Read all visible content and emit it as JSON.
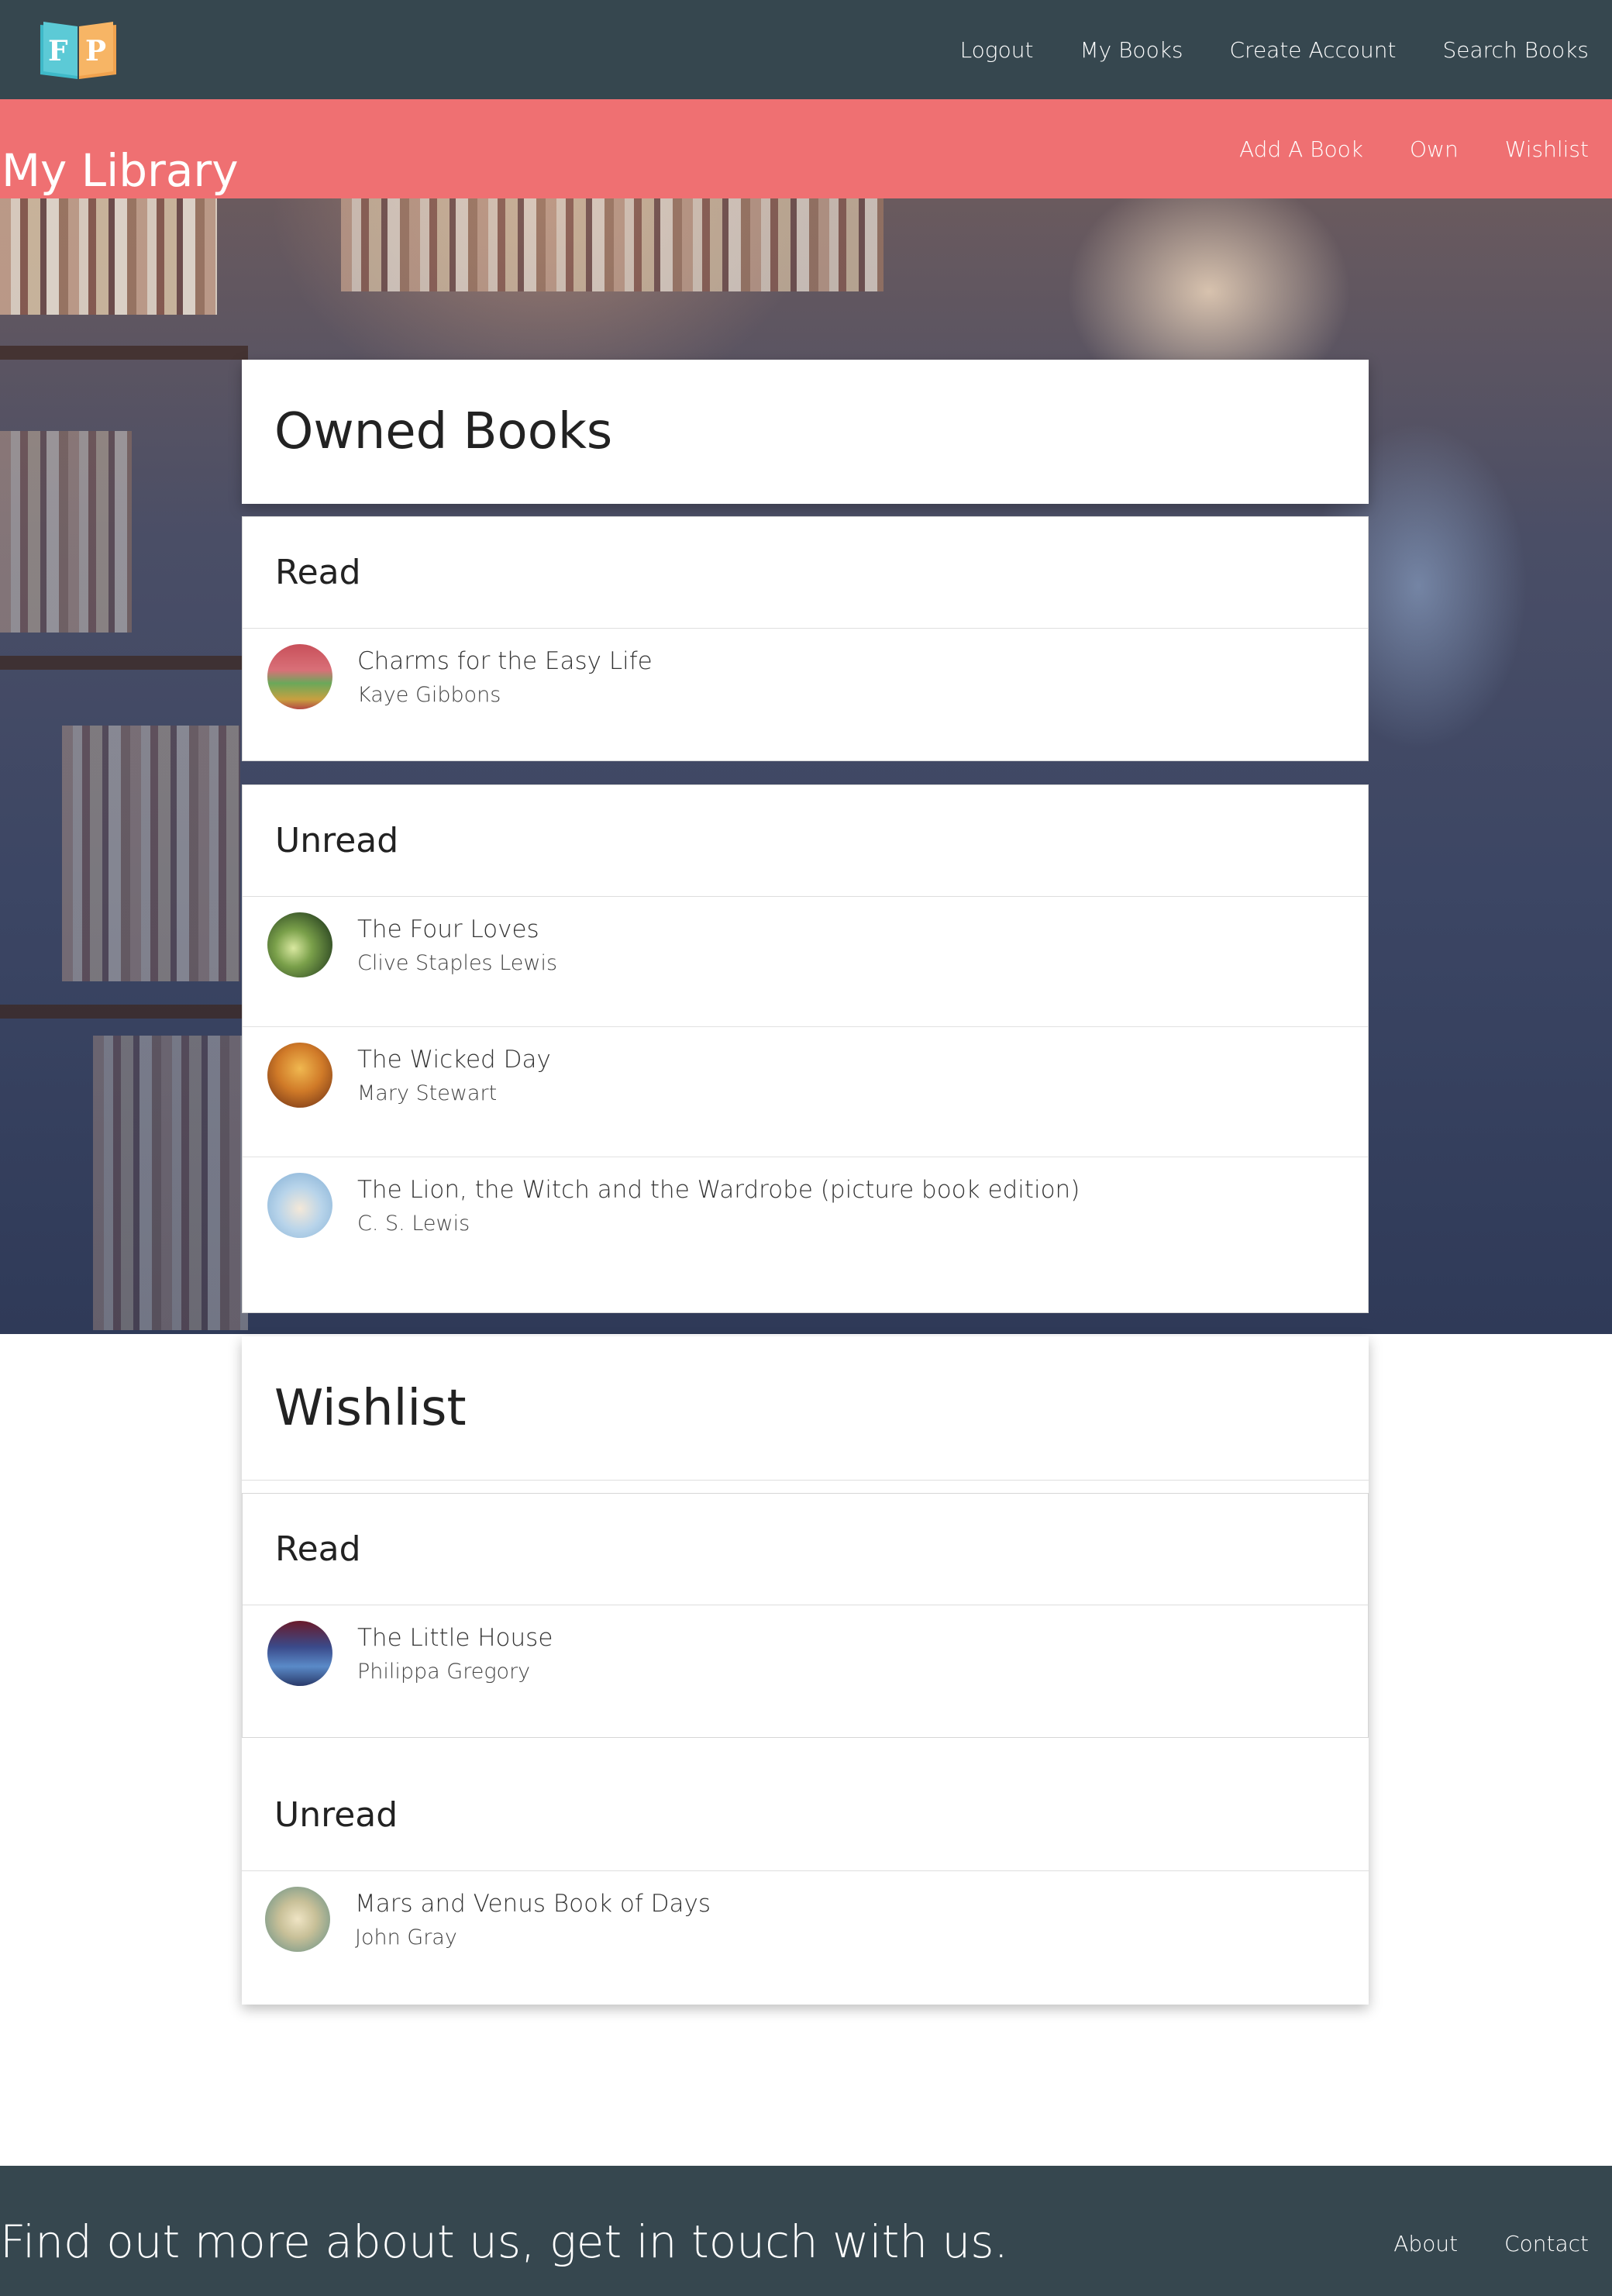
{
  "topnav": {
    "logo_letters": "F P",
    "links": [
      "Logout",
      "My Books",
      "Create Account",
      "Search Books"
    ]
  },
  "subnav": {
    "title": "My Library",
    "links": [
      "Add A Book",
      "Own",
      "Wishlist"
    ]
  },
  "owned": {
    "title": "Owned Books",
    "read": {
      "heading": "Read",
      "items": [
        {
          "title": "Charms for the Easy Life",
          "author": "Kaye Gibbons"
        }
      ]
    },
    "unread": {
      "heading": "Unread",
      "items": [
        {
          "title": "The Four Loves",
          "author": "Clive Staples Lewis"
        },
        {
          "title": "The Wicked Day",
          "author": "Mary Stewart"
        },
        {
          "title": "The Lion, the Witch and the Wardrobe (picture book edition)",
          "author": "C. S. Lewis"
        }
      ]
    }
  },
  "wishlist": {
    "title": "Wishlist",
    "read": {
      "heading": "Read",
      "items": [
        {
          "title": "The Little House",
          "author": "Philippa Gregory"
        }
      ]
    },
    "unread": {
      "heading": "Unread",
      "items": [
        {
          "title": "Mars and Venus Book of Days",
          "author": "John Gray"
        }
      ]
    }
  },
  "footer": {
    "tagline": "Find out more about us, get in touch with us.",
    "links": [
      "About",
      "Contact"
    ]
  },
  "colors": {
    "nav": "#36474f",
    "accent": "#ef7072"
  }
}
